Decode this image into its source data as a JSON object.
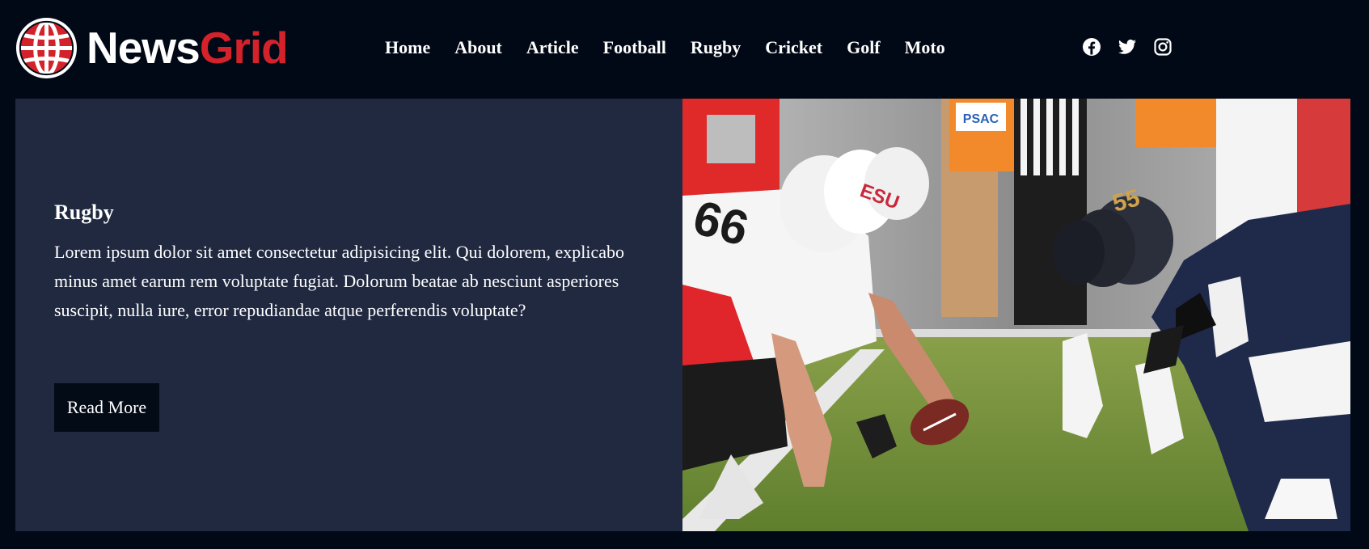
{
  "brand": {
    "name_part1": "News",
    "name_part2": "Grid"
  },
  "nav": {
    "items": [
      "Home",
      "About",
      "Article",
      "Football",
      "Rugby",
      "Cricket",
      "Golf",
      "Moto"
    ]
  },
  "social": {
    "icons": [
      "facebook-icon",
      "twitter-icon",
      "instagram-icon"
    ]
  },
  "feature": {
    "category": "Rugby",
    "body": "Lorem ipsum dolor sit amet consectetur adipisicing elit. Qui dolorem, explicabo minus amet earum rem voluptate fugiat. Dolorum beatae ab nesciunt asperiores suscipit, nulla iure, error repudiandae atque perferendis voluptate?",
    "cta": "Read More",
    "helmet_left_text": "ESU",
    "jersey_number_left": "66",
    "helmet_right_number": "55"
  },
  "colors": {
    "background": "#020916",
    "card": "#202940",
    "accent": "#d3222a"
  }
}
